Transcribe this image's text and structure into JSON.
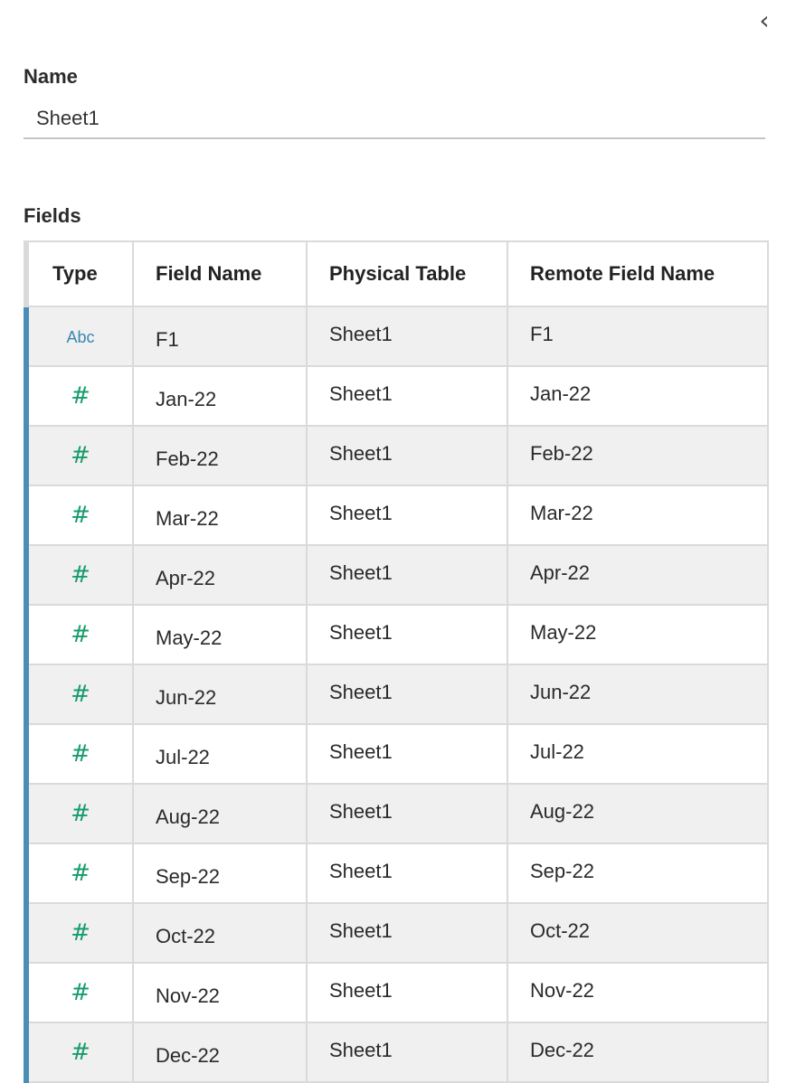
{
  "panel": {
    "collapse_icon": "chevron-left-icon",
    "collapse_glyph": "‹"
  },
  "name_section": {
    "label": "Name",
    "value": "Sheet1"
  },
  "fields_section": {
    "label": "Fields",
    "columns": [
      "Type",
      "Field Name",
      "Physical Table",
      "Remote Field Name"
    ],
    "rows": [
      {
        "type": "string",
        "type_glyph": "Abc",
        "field_name": "F1",
        "physical_table": "Sheet1",
        "remote_field_name": "F1"
      },
      {
        "type": "number",
        "type_glyph": "#",
        "field_name": "Jan-22",
        "physical_table": "Sheet1",
        "remote_field_name": "Jan-22"
      },
      {
        "type": "number",
        "type_glyph": "#",
        "field_name": "Feb-22",
        "physical_table": "Sheet1",
        "remote_field_name": "Feb-22"
      },
      {
        "type": "number",
        "type_glyph": "#",
        "field_name": "Mar-22",
        "physical_table": "Sheet1",
        "remote_field_name": "Mar-22"
      },
      {
        "type": "number",
        "type_glyph": "#",
        "field_name": "Apr-22",
        "physical_table": "Sheet1",
        "remote_field_name": "Apr-22"
      },
      {
        "type": "number",
        "type_glyph": "#",
        "field_name": "May-22",
        "physical_table": "Sheet1",
        "remote_field_name": "May-22"
      },
      {
        "type": "number",
        "type_glyph": "#",
        "field_name": "Jun-22",
        "physical_table": "Sheet1",
        "remote_field_name": "Jun-22"
      },
      {
        "type": "number",
        "type_glyph": "#",
        "field_name": "Jul-22",
        "physical_table": "Sheet1",
        "remote_field_name": "Jul-22"
      },
      {
        "type": "number",
        "type_glyph": "#",
        "field_name": "Aug-22",
        "physical_table": "Sheet1",
        "remote_field_name": "Aug-22"
      },
      {
        "type": "number",
        "type_glyph": "#",
        "field_name": "Sep-22",
        "physical_table": "Sheet1",
        "remote_field_name": "Sep-22"
      },
      {
        "type": "number",
        "type_glyph": "#",
        "field_name": "Oct-22",
        "physical_table": "Sheet1",
        "remote_field_name": "Oct-22"
      },
      {
        "type": "number",
        "type_glyph": "#",
        "field_name": "Nov-22",
        "physical_table": "Sheet1",
        "remote_field_name": "Nov-22"
      },
      {
        "type": "number",
        "type_glyph": "#",
        "field_name": "Dec-22",
        "physical_table": "Sheet1",
        "remote_field_name": "Dec-22"
      }
    ]
  },
  "colors": {
    "string_type": "#3a86b0",
    "number_type": "#169c6a",
    "row_accent": "#4a8db6"
  }
}
